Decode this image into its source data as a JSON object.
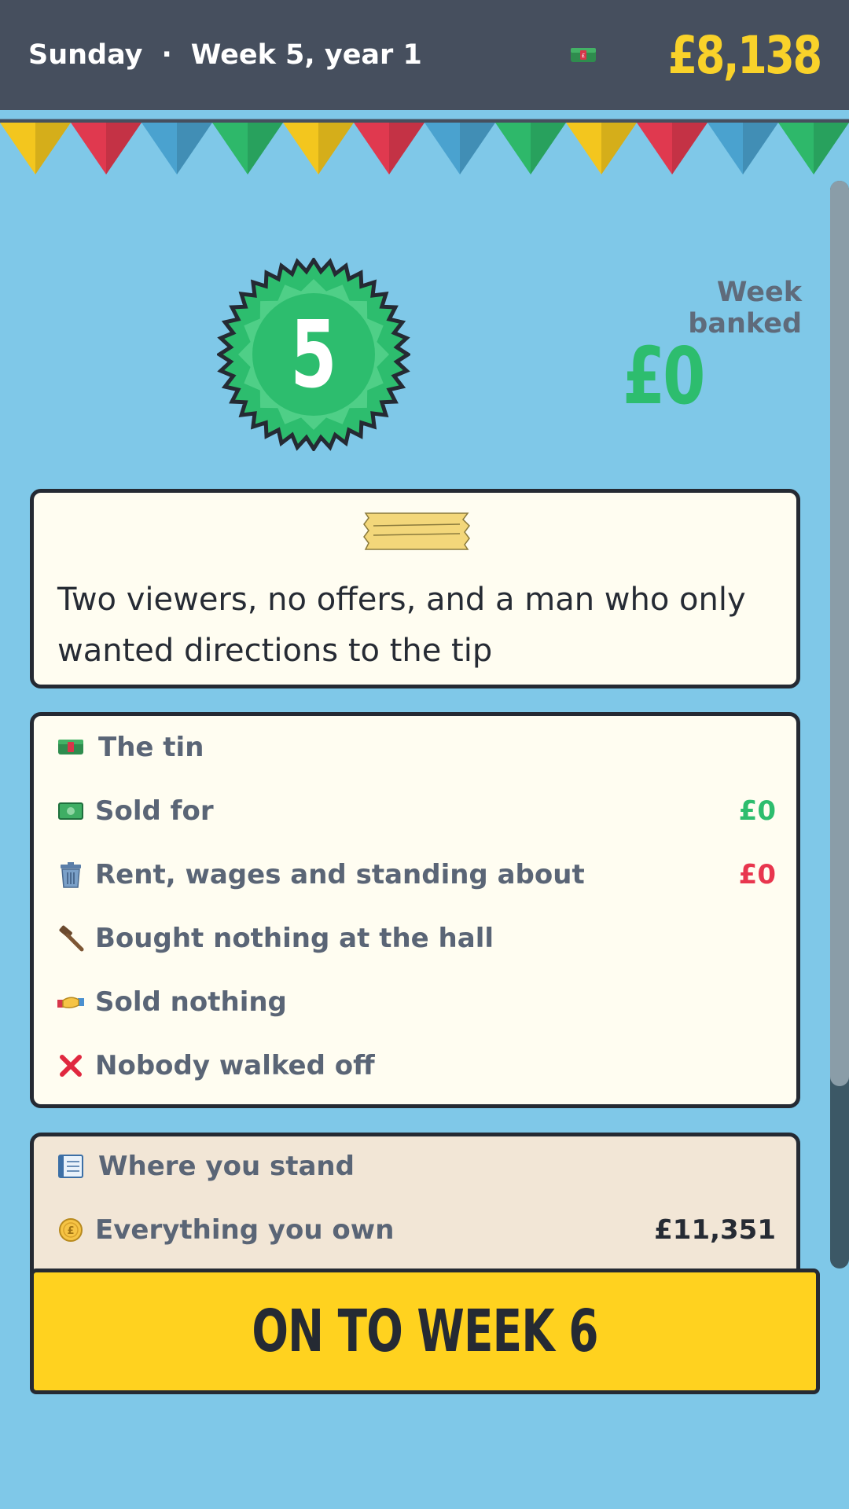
{
  "header": {
    "day": "Sunday",
    "separator": "·",
    "week": "Week 5, year 1",
    "cash": "£8,138",
    "cash_icon": "money-tin-icon"
  },
  "colors": {
    "background": "#7fc8e8",
    "header": "#464f5e",
    "gold": "#f9d22a",
    "green": "#2dbd6e",
    "red": "#e8364e",
    "card": "#fffdf1",
    "standing_card": "#f2e6d6",
    "button": "#ffd21f",
    "bunting": [
      "#f3c61e",
      "#e0394f",
      "#4aa2cf",
      "#2eb86a"
    ]
  },
  "week_badge": {
    "number": "5",
    "icon": "rosette-badge-icon"
  },
  "banked": {
    "label": "Week banked",
    "amount": "£0"
  },
  "quote": {
    "icon": "tape-strip-icon",
    "text": "Two viewers, no offers, and a man who only wanted directions to the tip"
  },
  "summary": {
    "title": "The tin",
    "title_icon": "money-tin-icon",
    "rows": [
      {
        "icon": "banknote-icon",
        "label": "Sold for",
        "value": "£0"
      },
      {
        "icon": "trash-can-icon",
        "label": "Rent, wages and standing about",
        "value": "£0"
      },
      {
        "icon": "gavel-icon",
        "label": "Bought nothing at the hall",
        "value": ""
      },
      {
        "icon": "handshake-icon",
        "label": "Sold nothing",
        "value": ""
      },
      {
        "icon": "cross-mark-icon",
        "label": "Nobody walked off",
        "value": ""
      }
    ]
  },
  "standing": {
    "title": "Where you stand",
    "title_icon": "ledger-icon",
    "rows": [
      {
        "icon": "coin-icon",
        "label": "Everything you own",
        "value": "£11,351"
      }
    ]
  },
  "cta": {
    "label": "ON TO WEEK 6"
  }
}
